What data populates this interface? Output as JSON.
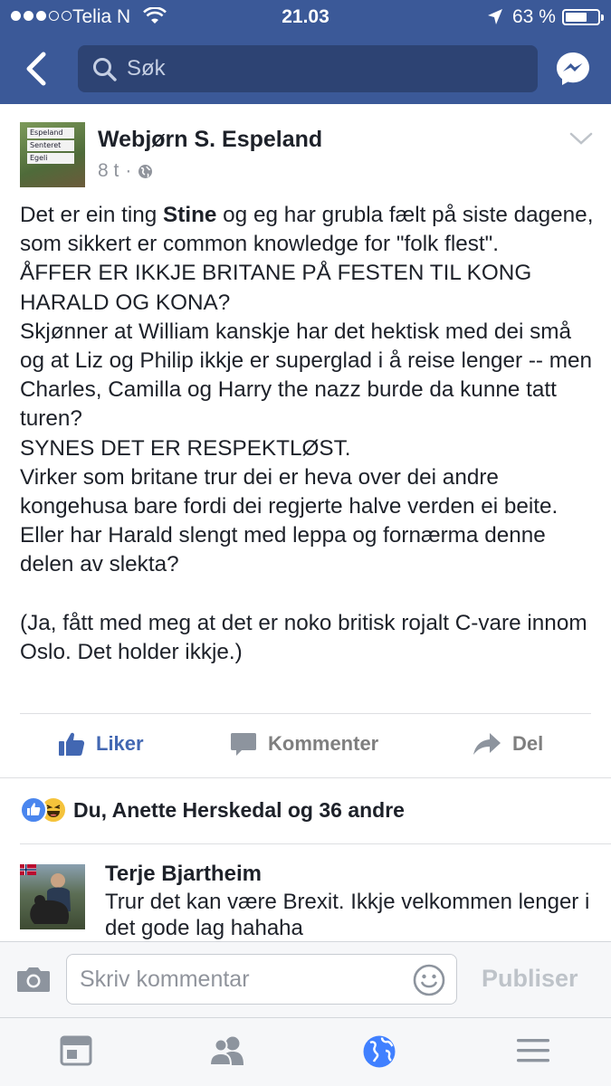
{
  "status_bar": {
    "carrier": "Telia N",
    "time": "21.03",
    "battery": "63 %",
    "battery_level": 0.63
  },
  "nav": {
    "search_placeholder": "Søk"
  },
  "post": {
    "author": "Webjørn S. Espeland",
    "time_ago": "8 t",
    "separator": "·",
    "body_paragraphs": [
      {
        "before": "Det er ein ting ",
        "bold": "Stine",
        "after": " og eg har grubla fælt på siste dagene, som sikkert er common knowledge for \"folk flest\"."
      },
      {
        "text": "ÅFFER ER IKKJE BRITANE PÅ FESTEN TIL KONG HARALD OG KONA?"
      },
      {
        "text": "Skjønner at William kanskje har det hektisk med dei små og at Liz og Philip ikkje er superglad i å reise lenger -- men Charles, Camilla og Harry the nazz burde da kunne tatt turen?"
      },
      {
        "text": "SYNES DET ER RESPEKTLØST."
      },
      {
        "text": "Virker som britane trur dei er heva over dei andre kongehusa bare fordi dei regjerte halve verden ei beite. Eller har Harald slengt med leppa og fornærma denne delen av slekta?"
      },
      {
        "text": "(Ja, fått med meg at det er noko britisk rojalt C-vare innom Oslo. Det holder ikkje.)"
      }
    ],
    "avatar_sign": [
      "Espeland",
      "Senteret",
      "Egeli"
    ],
    "actions": {
      "like": "Liker",
      "comment": "Kommenter",
      "share": "Del"
    },
    "reactions_text": "Du, Anette Herskedal og 36 andre"
  },
  "comment": {
    "author": "Terje Bjartheim",
    "text": "Trur det kan være Brexit. Ikkje velkommen lenger i det gode lag hahaha"
  },
  "composer": {
    "placeholder": "Skriv kommentar",
    "publish": "Publiser"
  },
  "tabbar": {
    "tabs": [
      "news-feed-icon",
      "friends-icon",
      "globe-icon",
      "menu-icon"
    ],
    "active": "globe-icon"
  },
  "colors": {
    "brand": "#3b5998",
    "link": "#4267b2",
    "active_tab": "#4080ff"
  }
}
